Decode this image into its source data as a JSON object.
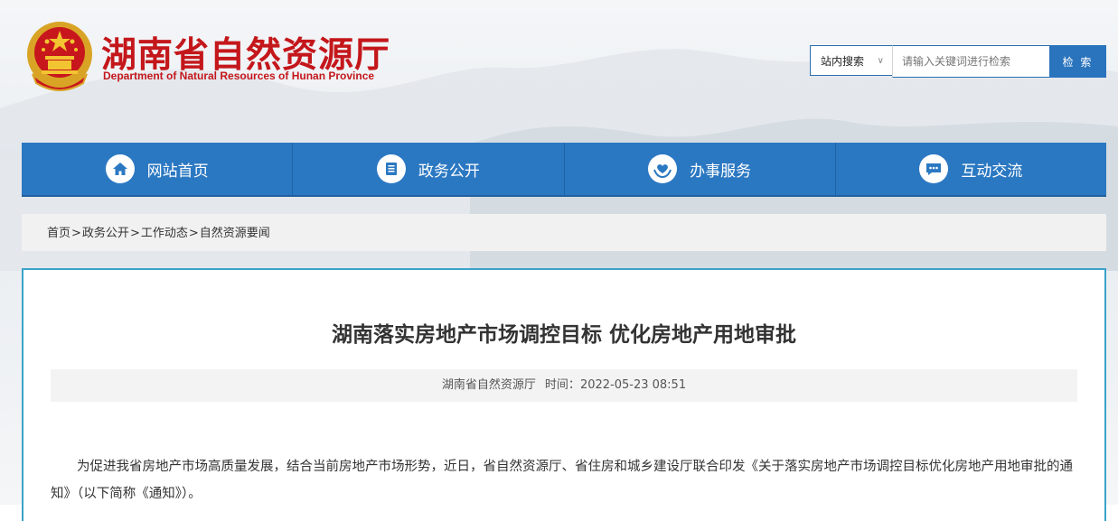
{
  "header": {
    "site_title": "湖南省自然资源厅",
    "site_subtitle": "Department of Natural Resources of Hunan Province"
  },
  "search": {
    "scope_label": "站内搜索",
    "placeholder": "请输入关键词进行检索",
    "button_label": "检 索"
  },
  "nav": {
    "items": [
      {
        "label": "网站首页",
        "icon": "home-icon"
      },
      {
        "label": "政务公开",
        "icon": "document-icon"
      },
      {
        "label": "办事服务",
        "icon": "heart-hands-icon"
      },
      {
        "label": "互动交流",
        "icon": "chat-icon"
      }
    ]
  },
  "breadcrumb": {
    "items": [
      "首页",
      "政务公开",
      "工作动态",
      "自然资源要闻"
    ],
    "separator": ">"
  },
  "article": {
    "title": "湖南落实房地产市场调控目标 优化房地产用地审批",
    "source": "湖南省自然资源厅",
    "time_label": "时间：",
    "time_value": "2022-05-23 08:51",
    "paragraph": "为促进我省房地产市场高质量发展，结合当前房地产市场形势，近日，省自然资源厅、省住房和城乡建设厅联合印发《关于落实房地产市场调控目标优化房地产用地审批的通知》（以下简称《通知》）。"
  },
  "colors": {
    "brand_red": "#c4171b",
    "nav_blue": "#2b78c2",
    "article_border": "#3aa3c8"
  }
}
